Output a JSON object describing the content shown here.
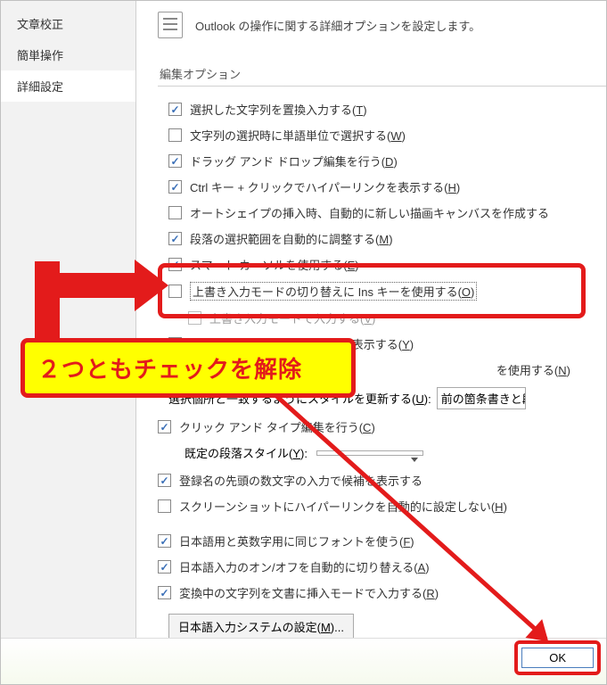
{
  "header": {
    "text": "Outlook の操作に関する詳細オプションを設定します。"
  },
  "sidebar": {
    "items": [
      {
        "label": "文章校正",
        "active": false
      },
      {
        "label": "簡単操作",
        "active": false
      },
      {
        "label": "詳細設定",
        "active": true
      }
    ]
  },
  "section_title": "編集オプション",
  "options": [
    {
      "checked": true,
      "indent": false,
      "disabled": false,
      "pre": "選択した文字列を置換入力する(",
      "ul": "T",
      "post": ")"
    },
    {
      "checked": false,
      "indent": false,
      "disabled": false,
      "pre": "文字列の選択時に単語単位で選択する(",
      "ul": "W",
      "post": ")"
    },
    {
      "checked": true,
      "indent": false,
      "disabled": false,
      "pre": "ドラッグ アンド ドロップ編集を行う(",
      "ul": "D",
      "post": ")"
    },
    {
      "checked": true,
      "indent": false,
      "disabled": false,
      "pre": "Ctrl キー + クリックでハイパーリンクを表示する(",
      "ul": "H",
      "post": ")"
    },
    {
      "checked": false,
      "indent": false,
      "disabled": false,
      "pre": "オートシェイプの挿入時、自動的に新しい描画キャンバスを作成する",
      "ul": "",
      "post": ""
    },
    {
      "checked": true,
      "indent": false,
      "disabled": false,
      "pre": "段落の選択範囲を自動的に調整する(",
      "ul": "M",
      "post": ")"
    },
    {
      "checked": true,
      "indent": false,
      "disabled": false,
      "pre": "スマート カーソルを使用する(",
      "ul": "E",
      "post": ")"
    },
    {
      "checked": false,
      "indent": false,
      "disabled": false,
      "focus": true,
      "pre": "上書き入力モードの切り替えに Ins キーを使用する(",
      "ul": "O",
      "post": ")"
    },
    {
      "checked": false,
      "indent": true,
      "disabled": true,
      "pre": "上書き入力モードで入力する(",
      "ul": "V",
      "post": ")"
    },
    {
      "checked": false,
      "indent": false,
      "disabled": false,
      "pre": "スタイルの更新のメッセージを表示する(",
      "ul": "Y",
      "post": ")"
    },
    {
      "plain": "を使用する(",
      "ul": "N",
      "post": ")"
    }
  ],
  "update_row": {
    "label_pre": "選択個所と一致するようにスタイルを更新する(",
    "label_ul": "U",
    "label_post": "):",
    "combo": "前の箇条書きと段"
  },
  "opt_click_type": {
    "checked": true,
    "pre": "クリック アンド タイプ編集を行う(",
    "ul": "C",
    "post": ")"
  },
  "default_style": {
    "label_pre": "既定の段落スタイル(",
    "label_ul": "Y",
    "label_post": "):",
    "value": ""
  },
  "opt_register": {
    "checked": true,
    "text": "登録名の先頭の数文字の入力で候補を表示する"
  },
  "opt_screenshot": {
    "checked": false,
    "pre": "スクリーンショットにハイパーリンクを自動的に設定しない(",
    "ul": "H",
    "post": ")"
  },
  "opt_jp_font": {
    "checked": true,
    "pre": "日本語用と英数字用に同じフォントを使う(",
    "ul": "F",
    "post": ")"
  },
  "opt_jp_toggle": {
    "checked": true,
    "pre": "日本語入力のオン/オフを自動的に切り替える(",
    "ul": "A",
    "post": ")"
  },
  "opt_convert": {
    "checked": true,
    "pre": "変換中の文字列を文書に挿入モードで入力する(",
    "ul": "R",
    "post": ")"
  },
  "ime_button": {
    "pre": "日本語入力システムの設定(",
    "ul": "M",
    "post": ")..."
  },
  "ok_label": "OK",
  "annotation_text": "２つともチェックを解除",
  "colors": {
    "accent_red": "#e31b1b",
    "highlight_yellow": "#ffff00"
  }
}
